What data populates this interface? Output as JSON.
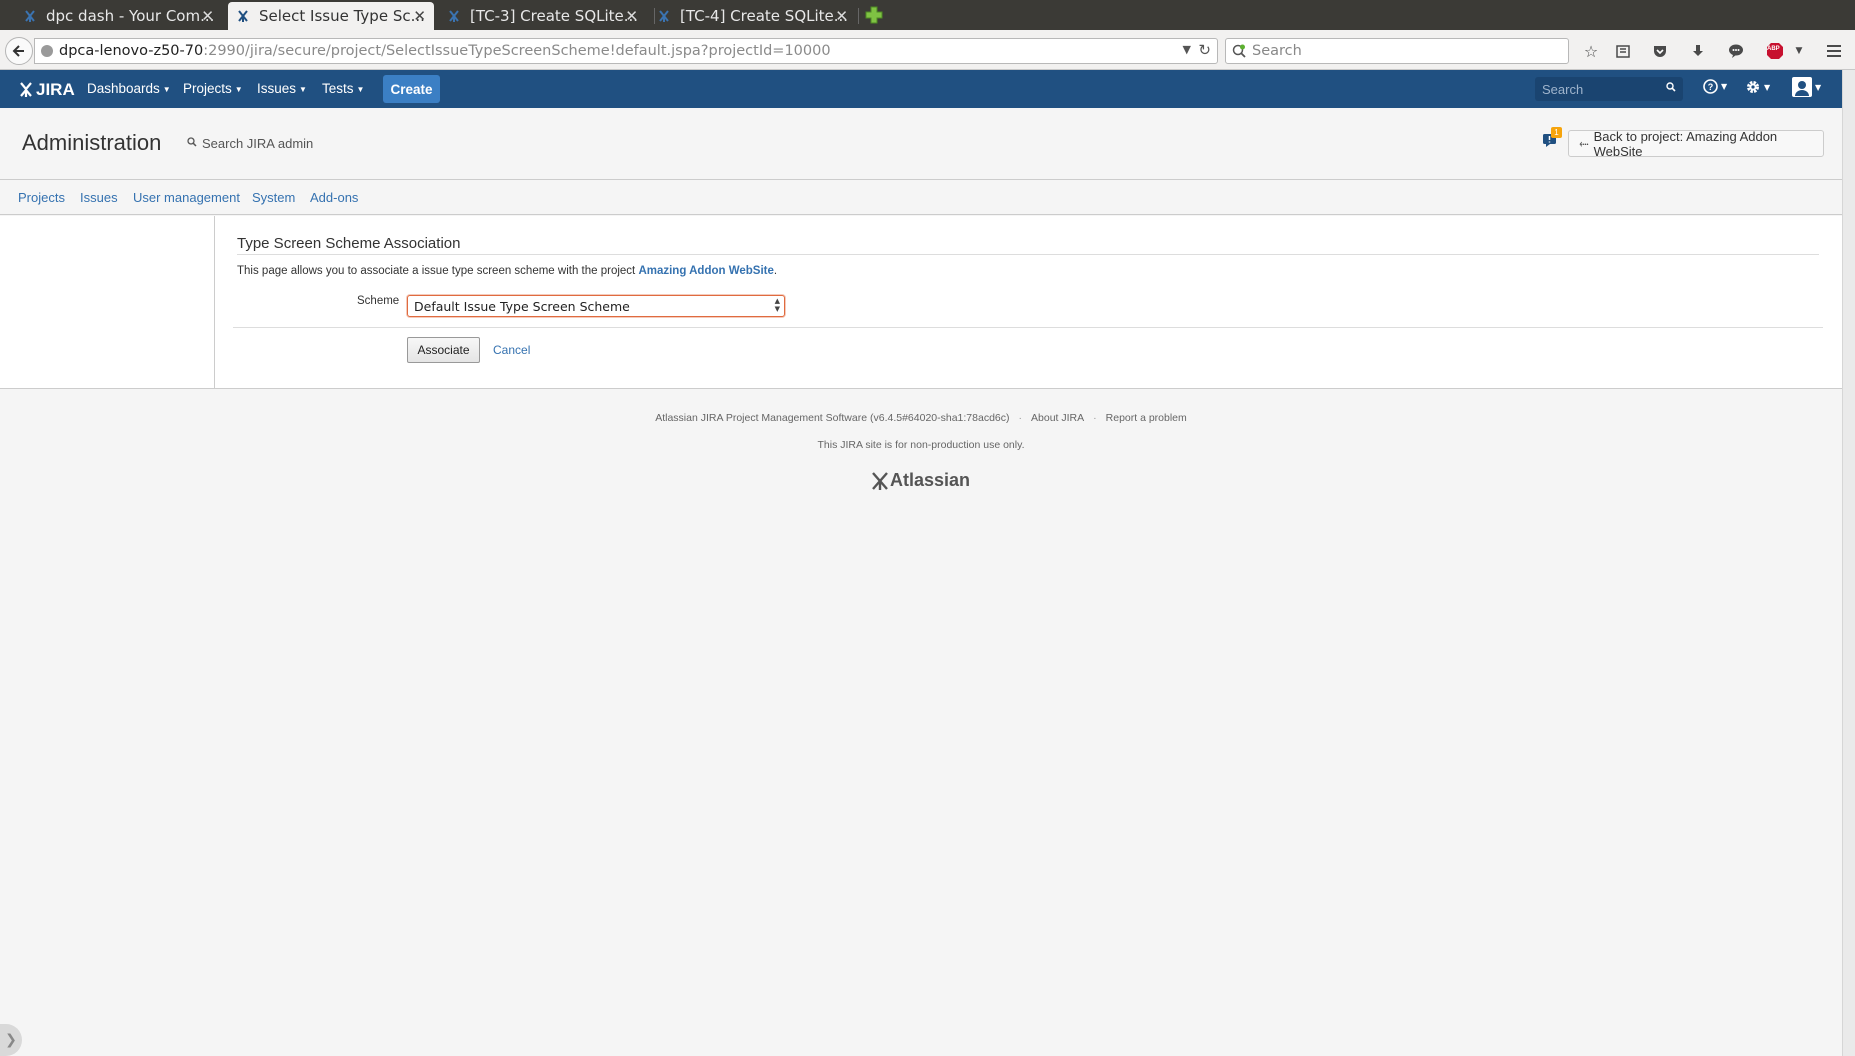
{
  "browser": {
    "tabs": [
      {
        "title": "dpc dash - Your Com...",
        "active": false
      },
      {
        "title": "Select Issue Type Sc...",
        "active": true
      },
      {
        "title": "[TC-3] Create SQLite...",
        "active": false
      },
      {
        "title": "[TC-4] Create SQLite...",
        "active": false
      }
    ],
    "url_host": "dpca-lenovo-z50-70",
    "url_path": ":2990/jira/secure/project/SelectIssueTypeScreenScheme!default.jspa?projectId=10000",
    "search_placeholder": "Search",
    "toolbar_icons": [
      "bookmark-star-icon",
      "reading-list-icon",
      "pocket-icon",
      "download-icon",
      "chat-icon",
      "adblock-icon",
      "menu-icon"
    ],
    "adblock_label": "ABP"
  },
  "jira_header": {
    "logo": "JIRA",
    "nav": [
      {
        "label": "Dashboards"
      },
      {
        "label": "Projects"
      },
      {
        "label": "Issues"
      },
      {
        "label": "Tests"
      }
    ],
    "create_label": "Create",
    "search_placeholder": "Search"
  },
  "admin": {
    "title": "Administration",
    "search_label": "Search JIRA admin",
    "notification_count": "1",
    "back_label": "Back to project: Amazing Addon WebSite",
    "tabs": [
      "Projects",
      "Issues",
      "User management",
      "System",
      "Add-ons"
    ]
  },
  "form": {
    "title": "Type Screen Scheme Association",
    "description_prefix": "This page allows you to associate a issue type screen scheme with the project ",
    "project_link": "Amazing Addon WebSite",
    "description_suffix": ".",
    "scheme_label": "Scheme",
    "scheme_selected": "Default Issue Type Screen Scheme",
    "associate_label": "Associate",
    "cancel_label": "Cancel"
  },
  "footer": {
    "software": "Atlassian JIRA Project Management Software (v6.4.5#64020-sha1:78acd6c)",
    "about": "About JIRA",
    "report": "Report a problem",
    "notice": "This JIRA site is for non-production use only.",
    "logo": "Atlassian"
  },
  "colors": {
    "header_bg": "#205081",
    "link": "#3572b0",
    "create_button": "#3b7fc4",
    "focus_border": "#e06b3f",
    "tabstrip_bg": "#3b3a36"
  }
}
